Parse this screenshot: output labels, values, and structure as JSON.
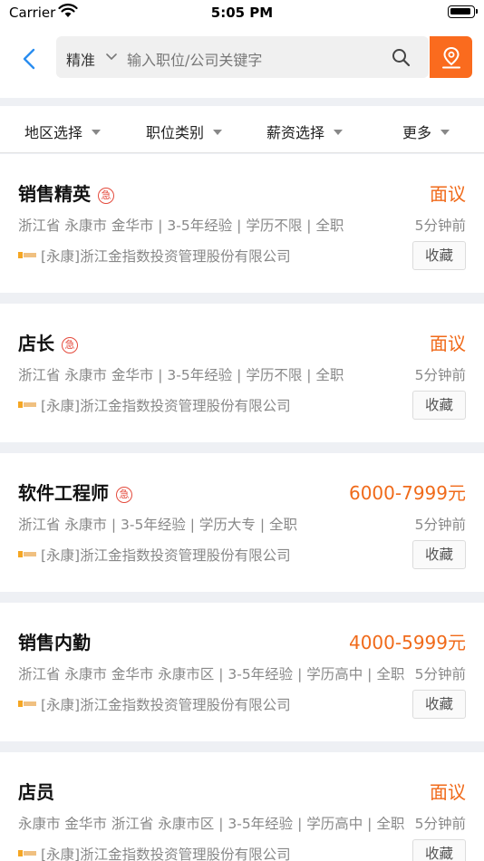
{
  "status_bar": {
    "carrier": "Carrier",
    "time": "5:05 PM"
  },
  "search": {
    "mode": "精准",
    "placeholder": "输入职位/公司关键字"
  },
  "filters": [
    "地区选择",
    "职位类别",
    "薪资选择",
    "更多"
  ],
  "colors": {
    "accent": "#fa6b1e",
    "salary": "#f06a1a",
    "urgent": "#e44a3c",
    "back_icon": "#2a8df0"
  },
  "icons": [
    "back-chevron-icon",
    "chevron-down-icon",
    "search-icon",
    "location-pin-icon",
    "wifi-icon",
    "battery-icon",
    "urgent-icon",
    "company-logo-icon"
  ],
  "urgent_label": "急",
  "fav_label": "收藏",
  "jobs": [
    {
      "title": "销售精英",
      "urgent": true,
      "salary": "面议",
      "meta": "浙江省 永康市 金华市 | 3-5年经验 | 学历不限 | 全职",
      "posted": "5分钟前",
      "company": "[永康]浙江金指数投资管理股份有限公司"
    },
    {
      "title": "店长",
      "urgent": true,
      "salary": "面议",
      "meta": "浙江省 永康市 金华市 | 3-5年经验 | 学历不限 | 全职",
      "posted": "5分钟前",
      "company": "[永康]浙江金指数投资管理股份有限公司"
    },
    {
      "title": "软件工程师",
      "urgent": true,
      "salary": "6000-7999元",
      "meta": "浙江省 永康市 | 3-5年经验 | 学历大专 | 全职",
      "posted": "5分钟前",
      "company": "[永康]浙江金指数投资管理股份有限公司"
    },
    {
      "title": "销售内勤",
      "urgent": false,
      "salary": "4000-5999元",
      "meta": "浙江省 永康市 金华市 永康市区 | 3-5年经验 | 学历高中 | 全职",
      "posted": "5分钟前",
      "company": "[永康]浙江金指数投资管理股份有限公司"
    },
    {
      "title": "店员",
      "urgent": false,
      "salary": "面议",
      "meta": "永康市 金华市 浙江省 永康市区 | 3-5年经验 | 学历高中 | 全职",
      "posted": "5分钟前",
      "company": "[永康]浙江金指数投资管理股份有限公司"
    }
  ]
}
